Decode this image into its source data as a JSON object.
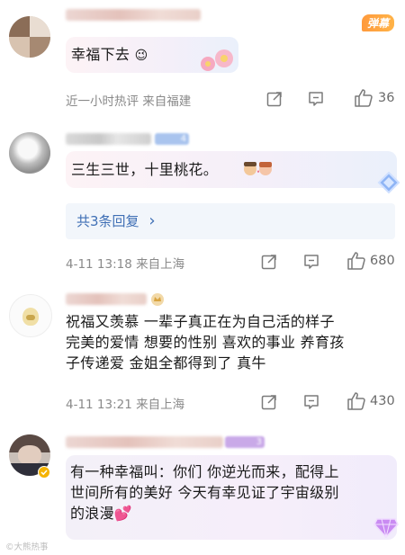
{
  "comments": [
    {
      "text": "幸福下去",
      "danmu_tag": "弹幕",
      "emoji_note": "😉",
      "time_location": "近一小时热评  来自福建",
      "likes": "36"
    },
    {
      "text": "三生三世，十里桃花。",
      "badge": "4",
      "replies_label": "共3条回复",
      "replies_arrow": "›",
      "time_location": "4-11 13:18  来自上海",
      "likes": "680"
    },
    {
      "text_lines": [
        "祝福又羡慕 一辈子真正在为自己活的样子",
        "完美的爱情 想要的性别 喜欢的事业 养育孩",
        "子传递爱 金姐全都得到了 真牛"
      ],
      "time_location": "4-11 13:21  来自上海",
      "likes": "430"
    },
    {
      "text_lines": [
        "有一种幸福叫：你们 你逆光而来，配得上",
        "世间所有的美好 今天有幸见证了宇宙级别",
        "的浪漫💕"
      ],
      "badge": "3"
    }
  ],
  "icons": {
    "share": "share-icon",
    "comment": "comment-icon",
    "like": "thumbs-up-icon",
    "gem": "diamond-icon"
  },
  "watermark": "©大熊热事",
  "colors": {
    "meta_gray": "#8a8a8a",
    "link_blue": "#3f6fb5",
    "danmu_orange": "#ff9a3c"
  }
}
